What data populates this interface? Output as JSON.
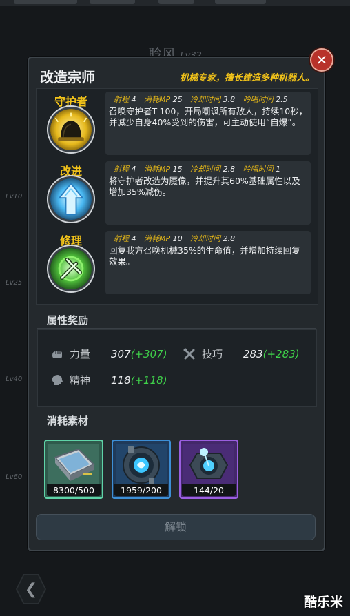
{
  "background": {
    "hero_name": "聆风",
    "hero_level": "Lv32",
    "level_markers": [
      "Lv10",
      "Lv25",
      "Lv40",
      "Lv60"
    ]
  },
  "watermark": "酷乐米",
  "dialog": {
    "title": "改造宗师",
    "subtitle": "机械专家，擅长建造多种机器人。",
    "close_icon": "close-icon"
  },
  "skills": [
    {
      "name": "守护者",
      "icon": "guardian-dome-icon",
      "stats": [
        {
          "label": "射程",
          "value": "4"
        },
        {
          "label": "消耗MP",
          "value": "25"
        },
        {
          "label": "冷却时间",
          "value": "3.8"
        },
        {
          "label": "吟唱时间",
          "value": "2.5"
        }
      ],
      "description": "召唤守护者T-100，开局嘲讽所有敌人，持续10秒，并减少自身40%受到的伤害，可主动使用“自爆”。"
    },
    {
      "name": "改进",
      "icon": "upgrade-arrow-icon",
      "stats": [
        {
          "label": "射程",
          "value": "4"
        },
        {
          "label": "消耗MP",
          "value": "15"
        },
        {
          "label": "冷却时间",
          "value": "2.8"
        },
        {
          "label": "吟唱时间",
          "value": "1"
        }
      ],
      "description": "将守护者改造为魇像，并提升其60%基础属性以及增加35%减伤。"
    },
    {
      "name": "修理",
      "icon": "repair-wrench-icon",
      "stats": [
        {
          "label": "射程",
          "value": "4"
        },
        {
          "label": "消耗MP",
          "value": "10"
        },
        {
          "label": "冷却时间",
          "value": "2.8"
        }
      ],
      "description": "回复我方召唤机械35%的生命值，并增加持续回复效果。"
    }
  ],
  "attributes": {
    "section_title": "属性奖励",
    "items": [
      {
        "icon": "strength-fist-icon",
        "label": "力量",
        "value": "307",
        "bonus": "(+307)"
      },
      {
        "icon": "skill-tools-icon",
        "label": "技巧",
        "value": "283",
        "bonus": "(+283)"
      },
      {
        "icon": "spirit-head-icon",
        "label": "精神",
        "value": "118",
        "bonus": "(+118)"
      }
    ]
  },
  "materials": {
    "section_title": "消耗素材",
    "items": [
      {
        "icon": "mech-plate-icon",
        "count": "8300/500",
        "rarity_color": "#5fd3a8"
      },
      {
        "icon": "blue-gear-core-icon",
        "count": "1959/200",
        "rarity_color": "#3d8fd6"
      },
      {
        "icon": "purple-gear-core-icon",
        "count": "144/20",
        "rarity_color": "#9b5fe0"
      }
    ]
  },
  "unlock_button": "解锁",
  "colors": {
    "accent_gold": "#f2c31a",
    "bonus_green": "#3fd14a",
    "close_red": "#b8322a"
  }
}
